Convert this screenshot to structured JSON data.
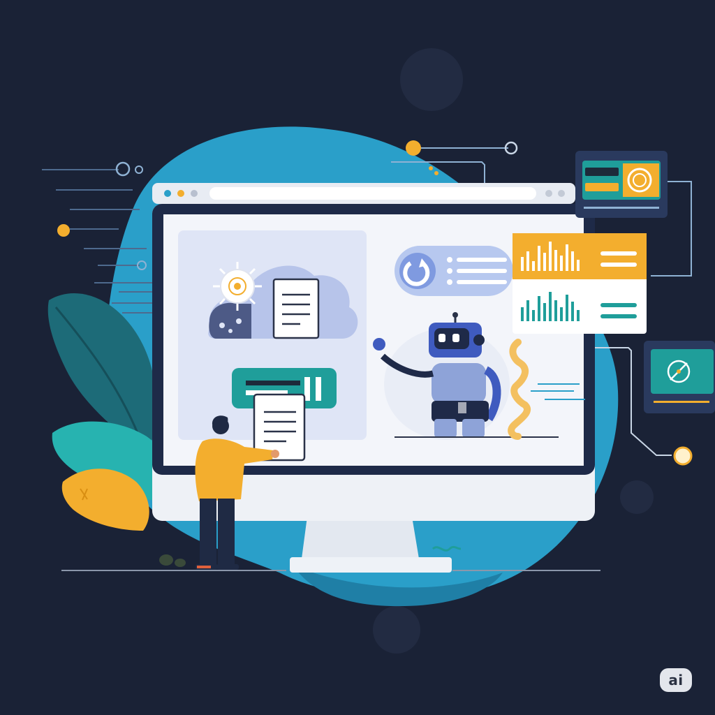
{
  "palette": {
    "background": "#1a2236",
    "blob": "#2a9fc9",
    "blob_dark": "#1f7fa6",
    "teal": "#1f9e9a",
    "orange": "#f3ae2e",
    "browser_frame": "#e8ecf3",
    "screen": "#f3f5fa",
    "panel_lavender": "#dfe5f6",
    "robot_blue": "#3f5bbf",
    "robot_light": "#8ea3d8",
    "person_shirt": "#f3ae2e",
    "person_pants": "#1f2a44"
  },
  "icons": {
    "cloud_document": "cloud-document-icon",
    "virus_gear": "virus-gear-icon",
    "document": "document-icon",
    "chat_refresh": "refresh-bubble-icon",
    "robot": "robot-icon",
    "bar_chart": "bar-chart-icon",
    "compass": "compass-icon",
    "target": "target-icon"
  },
  "badge": {
    "label": "ai"
  }
}
